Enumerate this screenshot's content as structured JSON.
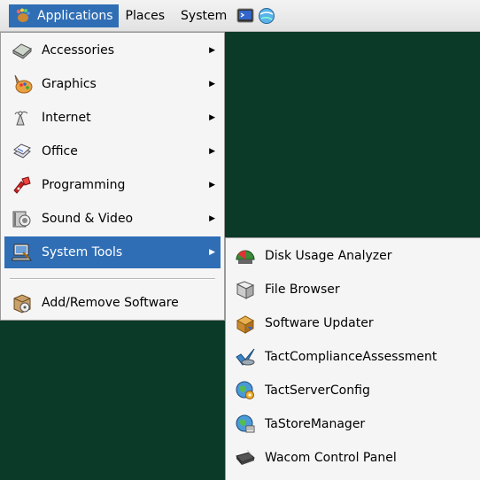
{
  "panel": {
    "applications_label": "Applications",
    "places_label": "Places",
    "system_label": "System"
  },
  "main_menu": {
    "items": [
      {
        "label": "Accessories",
        "icon": "accessories-icon"
      },
      {
        "label": "Graphics",
        "icon": "graphics-icon"
      },
      {
        "label": "Internet",
        "icon": "internet-icon"
      },
      {
        "label": "Office",
        "icon": "office-icon"
      },
      {
        "label": "Programming",
        "icon": "programming-icon"
      },
      {
        "label": "Sound & Video",
        "icon": "sound-video-icon"
      },
      {
        "label": "System Tools",
        "icon": "system-tools-icon"
      },
      {
        "label": "Add/Remove Software",
        "icon": "add-remove-software-icon"
      }
    ]
  },
  "system_tools_menu": {
    "items": [
      {
        "label": "Disk Usage Analyzer",
        "icon": "disk-usage-analyzer-icon"
      },
      {
        "label": "File Browser",
        "icon": "file-browser-icon"
      },
      {
        "label": "Software Updater",
        "icon": "software-updater-icon"
      },
      {
        "label": "TactComplianceAssessment",
        "icon": "compliance-assessment-icon"
      },
      {
        "label": "TactServerConfig",
        "icon": "server-config-icon"
      },
      {
        "label": "TaStoreManager",
        "icon": "store-manager-icon"
      },
      {
        "label": "Wacom Control Panel",
        "icon": "wacom-tablet-icon"
      }
    ]
  },
  "colors": {
    "desktop": "#0b3a28",
    "highlight": "#2f6eb5",
    "menu_bg": "#f5f5f5"
  }
}
